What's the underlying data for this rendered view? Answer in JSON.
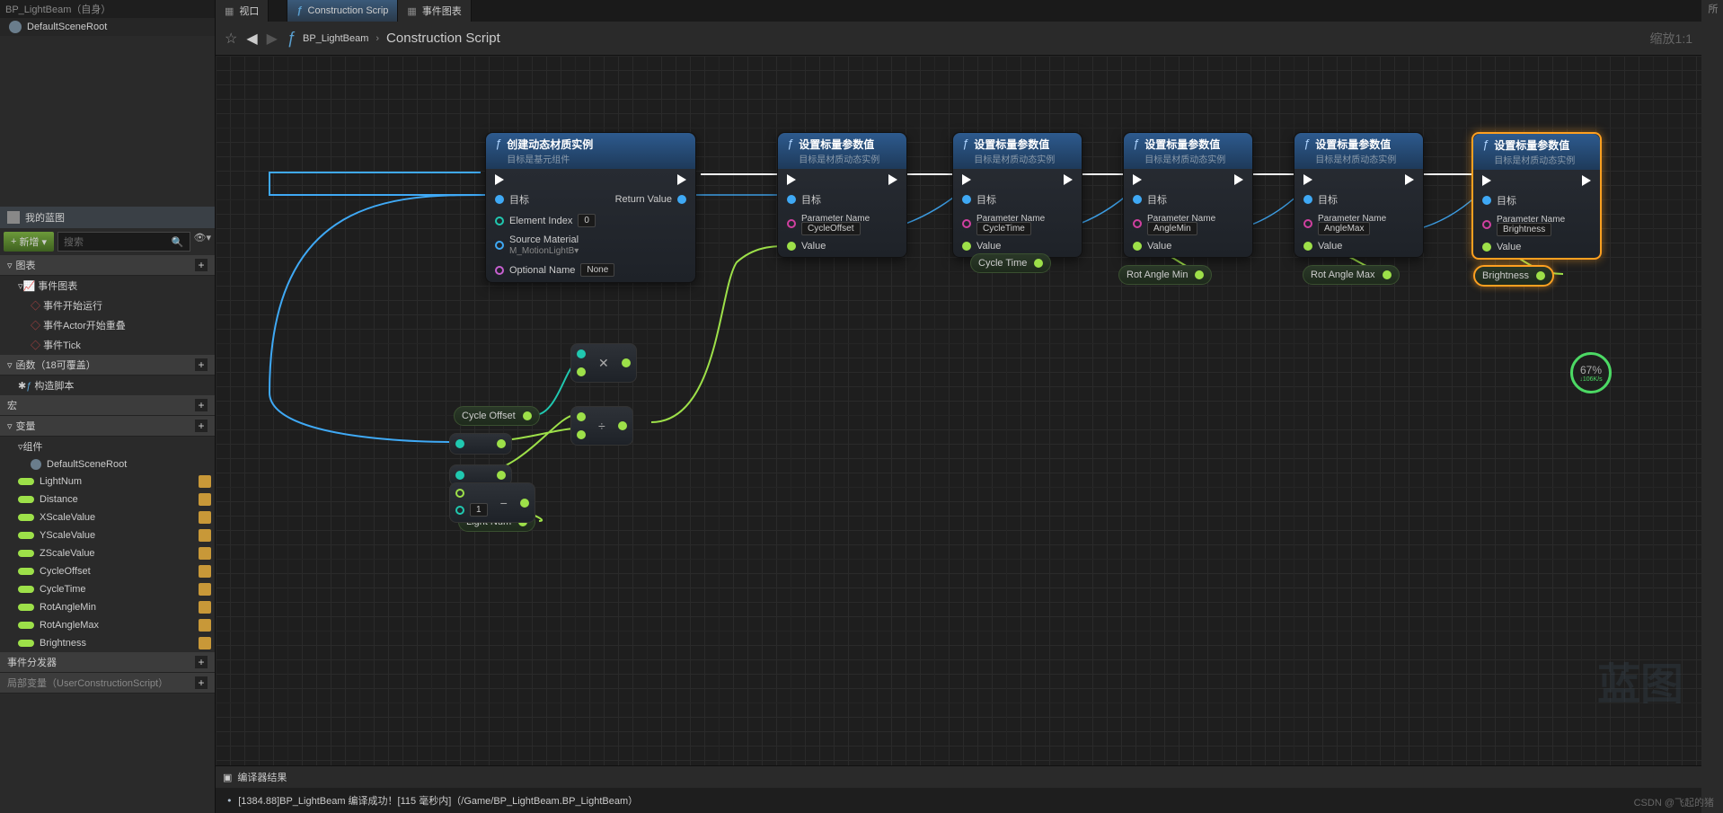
{
  "components": {
    "title": "BP_LightBeam（自身）",
    "default_root": "DefaultSceneRoot"
  },
  "my_blueprint": {
    "title": "我的蓝图",
    "new_button": "新增",
    "search_placeholder": "搜索",
    "categories": {
      "graphs": "图表",
      "event_graph": "事件图表",
      "events": [
        "事件开始运行",
        "事件Actor开始重叠",
        "事件Tick"
      ],
      "functions": "函数（18可覆盖）",
      "construction": "构造脚本",
      "macros": "宏",
      "variables": "变量",
      "components": "组件",
      "default_scene_root": "DefaultSceneRoot",
      "var_list": [
        "LightNum",
        "Distance",
        "XScaleValue",
        "YScaleValue",
        "ZScaleValue",
        "CycleOffset",
        "CycleTime",
        "RotAngleMin",
        "RotAngleMax",
        "Brightness"
      ],
      "dispatchers": "事件分发器",
      "locals": "局部变量（UserConstructionScript）"
    }
  },
  "tabs": {
    "viewport": "视口",
    "construction": "Construction Scrip",
    "event_graph": "事件图表"
  },
  "breadcrumb": {
    "root": "BP_LightBeam",
    "leaf": "Construction Script",
    "zoom": "缩放1:1"
  },
  "nodes": {
    "create_dmi": {
      "title": "创建动态材质实例",
      "subtitle": "目标是基元组件",
      "target": "目标",
      "return": "Return Value",
      "elem_index": "Element Index",
      "elem_val": "0",
      "source_mat": "Source Material",
      "source_val": "M_MotionLightB▾",
      "opt_name": "Optional Name",
      "opt_val": "None"
    },
    "set_scalar": {
      "title": "设置标量参数值",
      "subtitle": "目标是材质动态实例",
      "target": "目标",
      "param_name": "Parameter Name",
      "value": "Value"
    },
    "params": {
      "p1": "CycleOffset",
      "p2": "CycleTime",
      "p3": "AngleMin",
      "p4": "AngleMax",
      "p5": "Brightness"
    },
    "var_labels": {
      "cycle_offset": "Cycle Offset",
      "cycle_time": "Cycle Time",
      "rot_min": "Rot Angle Min",
      "rot_max": "Rot Angle Max",
      "brightness": "Brightness",
      "light_num": "Light Num"
    },
    "const_one": "1"
  },
  "compiler": {
    "title": "编译器结果",
    "log": "[1384.88]BP_LightBeam 编译成功！[115 毫秒内]（/Game/BP_LightBeam.BP_LightBeam）"
  },
  "perf": {
    "pct": "67%",
    "rate": "↓106K/s"
  },
  "watermark": "蓝图",
  "credit": "CSDN @飞起的猪",
  "right_label": "所"
}
